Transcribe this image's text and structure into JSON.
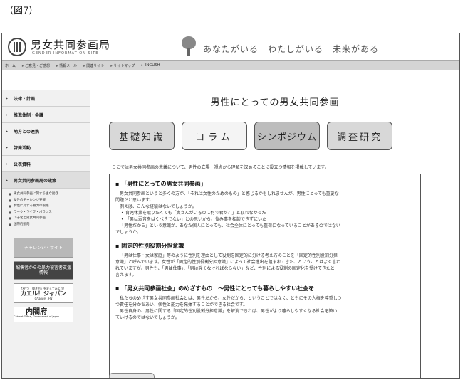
{
  "figure_label": "（図7）",
  "header": {
    "site_title": "男女共同参画局",
    "site_subtitle": "GENDER INFORMATION SITE",
    "slogan": "あなたがいる　わたしがいる　未来がある"
  },
  "navbar": {
    "items": [
      "ホーム",
      "ご意見・ご感想",
      "情報メール",
      "関連サイト",
      "サイトマップ",
      "ENGLISH"
    ]
  },
  "sidebar": {
    "items": [
      {
        "label": "法律・計画"
      },
      {
        "label": "推進体制・会議"
      },
      {
        "label": "地方との連携"
      },
      {
        "label": "啓発活動"
      },
      {
        "label": "公表資料"
      },
      {
        "label": "男女共同参画局の政策"
      }
    ],
    "sub_items": [
      "男女共同参画に関する主な動き",
      "女性のチャレンジ支援",
      "女性に対する暴力の根絶",
      "ワーク・ライフ・バランス",
      "少子化と男女共同参画",
      "国際的動向"
    ],
    "banners": {
      "challenge": "チャレンジ・サイト",
      "violence": "配偶者からの暴力被害者支援情報",
      "change_japan_top": "ひとつ「働き方」を変えてみよう！",
      "change_japan": "カエル！ジャパン",
      "change_japan_sub": "Change! JPN",
      "cabinet": "内閣府",
      "cabinet_en": "Cabinet Office, Government of Japan"
    }
  },
  "main": {
    "page_title": "男性にとっての男女共同参画",
    "tabs": [
      "基礎知識",
      "コラム",
      "シンポジウム",
      "調査研究"
    ],
    "intro": "ここでは男女共同参画の意義について、男性の立場・視点から理解を深めることに役立つ情報を掲載しています。",
    "sections": {
      "s1": {
        "heading": "「男性にとっての男女共同参画」",
        "p1": "男女共同参画というと多くの方が、「それは女性のためのもの」と感じるかもしれませんが、男性にとっても重要な",
        "p2": "問題だと思います。",
        "p3": "例えば、こんな経験はないでしょうか。",
        "b1": "育児休業を取りたくても「奥さんがいるのに何で君が？」と取れなかった",
        "b2": "「男は弱音をはくべきでない」との思いから、悩み事を相談できずにいた",
        "p4": "「男性だから」という意識が、あなた個人にとっても、社会全体にとっても重荷になっていることがあるのではない",
        "p5": "でしょうか。"
      },
      "s2": {
        "heading": "固定的性別役割分担意識",
        "p1": "「男は仕事・女は家庭」等のように性別を理由として役割を固定的に分ける考え方のことを「固定的性別役割分担",
        "p2": "意識」と呼んでいます。女性が「固定的性別役割分担意識」によって社会進出を阻まれてきた、ということはよく言わ",
        "p3": "れていますが、男性も、「男は仕事」、「男は強くなければならない」など、性別による役割の固定化を受けてきたと",
        "p4": "言えます。"
      },
      "s3": {
        "heading": "「男女共同参画社会」のめざすもの　～男性にとっても暮らしやすい社会を",
        "p1": "私たちのめざす男女共同参画社会とは、男性だから、女性だから、ということではなく、ともにその人権を尊重しつ",
        "p2": "つ責任を分かちあい、個性と能力を発揮することができる社会です。",
        "p3": "男性自身の、男性に関する「固定的性別役割分担意識」を解消できれば、男性がより暮らしやすくなる社会を築い",
        "p4": "ていけるのではないでしょうか。"
      }
    }
  }
}
